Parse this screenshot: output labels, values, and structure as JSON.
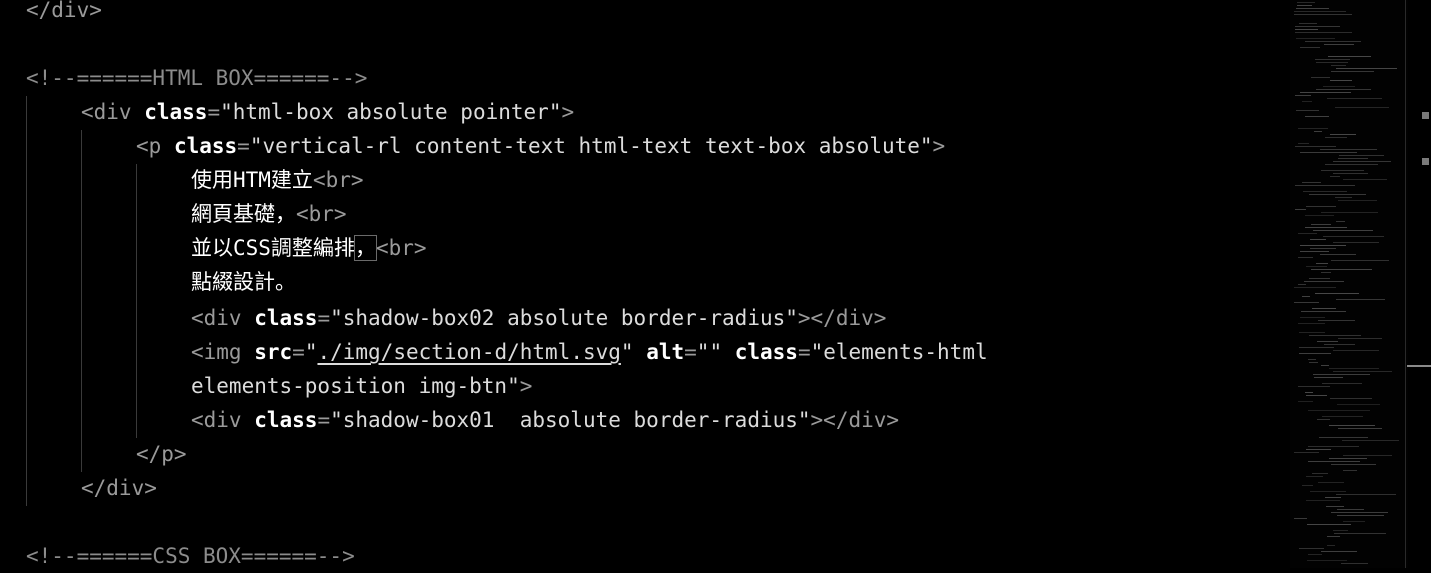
{
  "editor": {
    "lines": [
      {
        "indent": 0,
        "segments": [
          {
            "t": "</div>",
            "c": "tag"
          }
        ]
      },
      {
        "indent": 0,
        "segments": []
      },
      {
        "indent": 0,
        "segments": [
          {
            "t": "<!--======HTML BOX======-->",
            "c": "cm"
          }
        ]
      },
      {
        "indent": 1,
        "segments": [
          {
            "t": "<div ",
            "c": "tag"
          },
          {
            "t": "class",
            "c": "attr"
          },
          {
            "t": "=",
            "c": "tag"
          },
          {
            "t": "\"html-box absolute pointer\"",
            "c": "str"
          },
          {
            "t": ">",
            "c": "tag"
          }
        ]
      },
      {
        "indent": 2,
        "segments": [
          {
            "t": "<p ",
            "c": "tag"
          },
          {
            "t": "class",
            "c": "attr"
          },
          {
            "t": "=",
            "c": "tag"
          },
          {
            "t": "\"vertical-rl content-text html-text text-box absolute\"",
            "c": "str"
          },
          {
            "t": ">",
            "c": "tag"
          }
        ]
      },
      {
        "indent": 3,
        "segments": [
          {
            "t": "使用HTM建立",
            "c": "txt"
          },
          {
            "t": "<br>",
            "c": "tag"
          }
        ]
      },
      {
        "indent": 3,
        "segments": [
          {
            "t": "網頁基礎，",
            "c": "txt"
          },
          {
            "t": "<br>",
            "c": "tag"
          }
        ]
      },
      {
        "indent": 3,
        "segments": [
          {
            "t": "並以CSS調整編排",
            "c": "txt"
          },
          {
            "t": "，",
            "c": "txt cursor-box"
          },
          {
            "t": "<br>",
            "c": "tag"
          }
        ]
      },
      {
        "indent": 3,
        "segments": [
          {
            "t": "點綴設計。",
            "c": "txt"
          }
        ]
      },
      {
        "indent": 3,
        "segments": [
          {
            "t": "<div ",
            "c": "tag"
          },
          {
            "t": "class",
            "c": "attr"
          },
          {
            "t": "=",
            "c": "tag"
          },
          {
            "t": "\"shadow-box02 absolute border-radius\"",
            "c": "str"
          },
          {
            "t": "></div>",
            "c": "tag"
          }
        ]
      },
      {
        "indent": 3,
        "segments": [
          {
            "t": "<img ",
            "c": "tag"
          },
          {
            "t": "src",
            "c": "attr"
          },
          {
            "t": "=",
            "c": "tag"
          },
          {
            "t": "\"",
            "c": "str"
          },
          {
            "t": "./img/section-d/html.svg",
            "c": "str link"
          },
          {
            "t": "\" ",
            "c": "str"
          },
          {
            "t": "alt",
            "c": "attr"
          },
          {
            "t": "=",
            "c": "tag"
          },
          {
            "t": "\"\" ",
            "c": "str"
          },
          {
            "t": "class",
            "c": "attr"
          },
          {
            "t": "=",
            "c": "tag"
          },
          {
            "t": "\"elements-html",
            "c": "str"
          }
        ]
      },
      {
        "indent": 3,
        "segments": [
          {
            "t": "elements-position img-btn\"",
            "c": "str"
          },
          {
            "t": ">",
            "c": "tag"
          }
        ]
      },
      {
        "indent": 3,
        "segments": [
          {
            "t": "<div ",
            "c": "tag"
          },
          {
            "t": "class",
            "c": "attr"
          },
          {
            "t": "=",
            "c": "tag"
          },
          {
            "t": "\"shadow-box01  absolute border-radius\"",
            "c": "str"
          },
          {
            "t": "></div>",
            "c": "tag"
          }
        ]
      },
      {
        "indent": 2,
        "segments": [
          {
            "t": "</p>",
            "c": "tag"
          }
        ]
      },
      {
        "indent": 1,
        "segments": [
          {
            "t": "</div>",
            "c": "tag"
          }
        ]
      },
      {
        "indent": 0,
        "segments": []
      },
      {
        "indent": 0,
        "segments": [
          {
            "t": "<!--======CSS BOX======-->",
            "c": "cm"
          }
        ]
      }
    ]
  }
}
